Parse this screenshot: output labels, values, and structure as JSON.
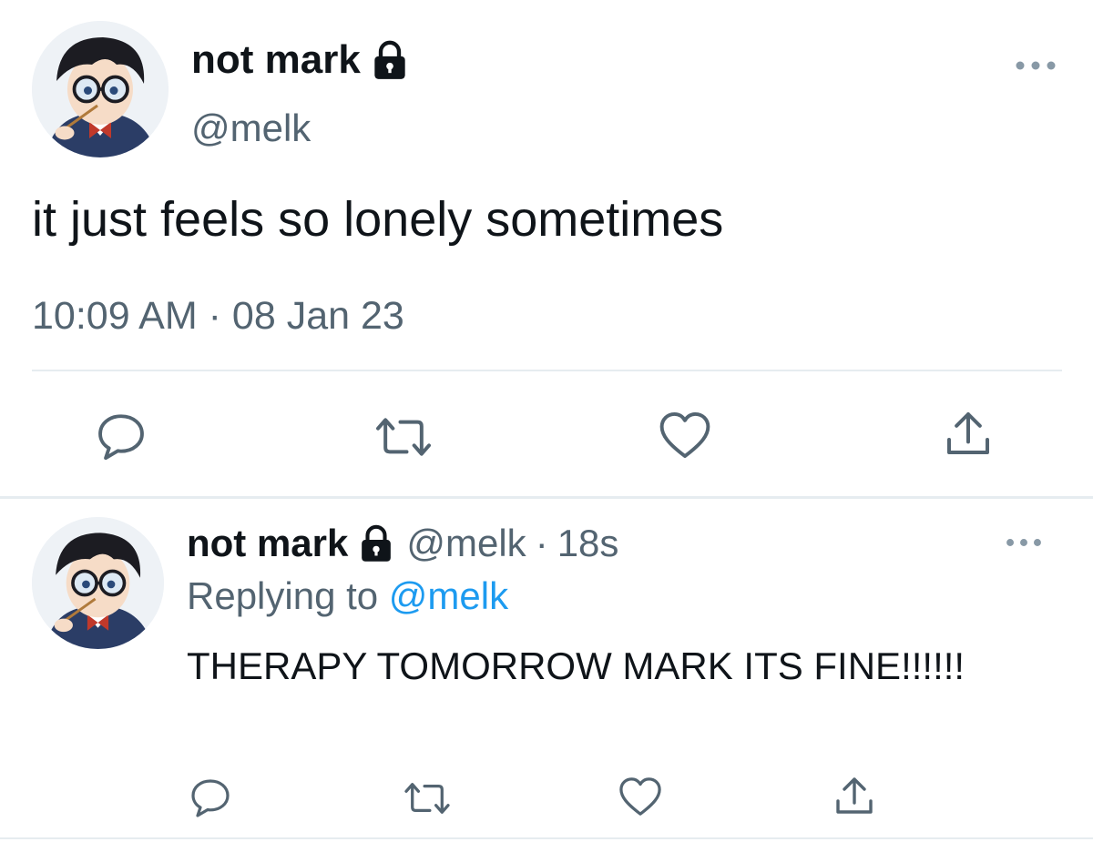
{
  "main_tweet": {
    "display_name": "not mark",
    "handle": "@melk",
    "text": "it just feels so lonely sometimes",
    "time": "10:09 AM",
    "separator": "·",
    "date": "08 Jan 23",
    "protected": true,
    "actions": [
      "reply-icon",
      "retweet-icon",
      "like-icon",
      "share-icon"
    ]
  },
  "reply_tweet": {
    "display_name": "not mark",
    "handle": "@melk",
    "separator": "·",
    "time_ago": "18s",
    "replying_prefix": "Replying to",
    "replying_to": "@melk",
    "text": "THERAPY TOMORROW MARK ITS FINE!!!!!!",
    "protected": true,
    "actions": [
      "reply-icon",
      "retweet-icon",
      "like-icon",
      "share-icon"
    ]
  },
  "colors": {
    "text": "#0f1419",
    "secondary": "#536471",
    "link": "#1d9bf0",
    "icon": "#8899a6",
    "divider": "#e6ecf0"
  }
}
